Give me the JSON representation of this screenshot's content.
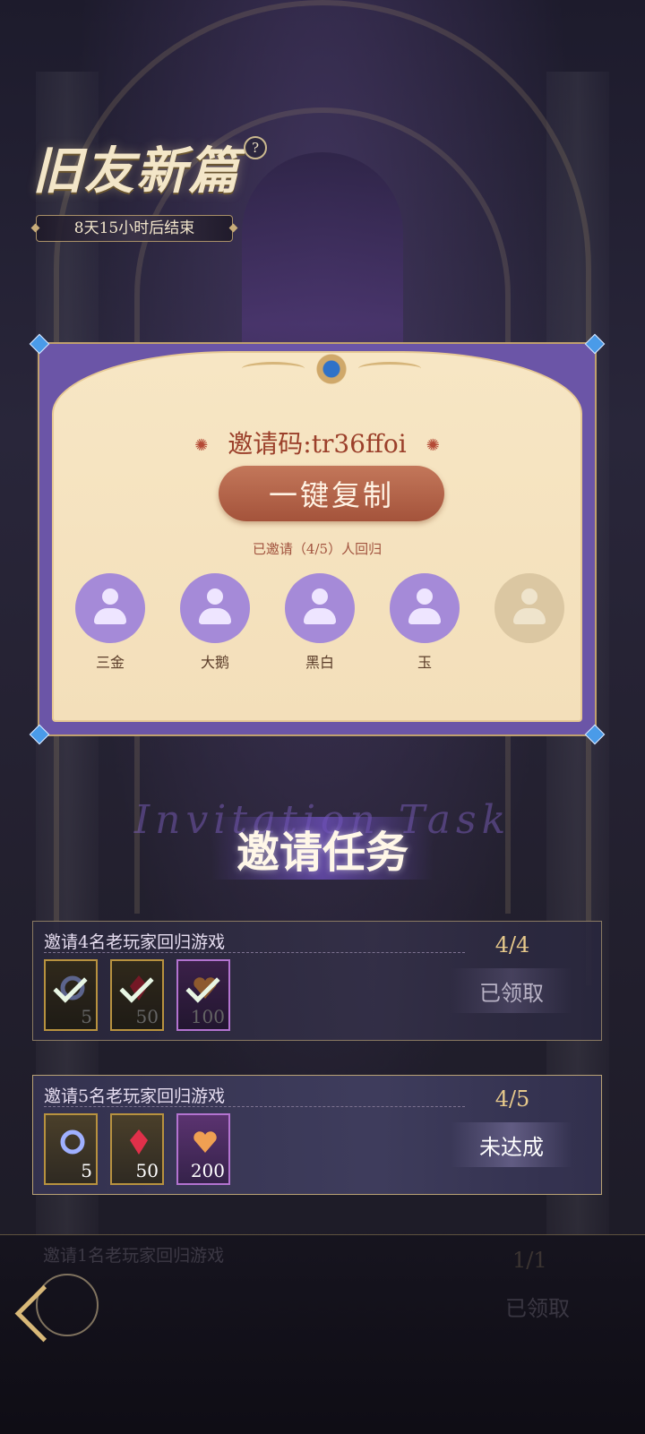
{
  "event": {
    "title": "旧友新篇",
    "help_icon": "question-mark-icon",
    "help_glyph": "?",
    "timer": "8天15小时后结束"
  },
  "invite": {
    "code_text": "邀请码:tr36ffoi",
    "copy_button": "一键复制",
    "status_text": "已邀请（4/5）人回归",
    "friends": [
      {
        "name": "三金",
        "state": "joined"
      },
      {
        "name": "大鹅",
        "state": "joined"
      },
      {
        "name": "黑白",
        "state": "joined"
      },
      {
        "name": "玉",
        "state": "joined"
      },
      {
        "name": "",
        "state": "empty"
      }
    ]
  },
  "tasks_section": {
    "title": "邀请任务",
    "bg_text": "Invitation Task"
  },
  "tasks": [
    {
      "title": "邀请4名老玩家回归游戏",
      "progress": "4/4",
      "button": "已领取",
      "state": "claimed",
      "rewards": [
        {
          "icon": "ring-icon",
          "count": "5",
          "rarity": "gold",
          "claimed": true
        },
        {
          "icon": "crystal-icon",
          "count": "50",
          "rarity": "gold",
          "claimed": true
        },
        {
          "icon": "heart-icon",
          "count": "100",
          "rarity": "purple",
          "claimed": true
        }
      ]
    },
    {
      "title": "邀请5名老玩家回归游戏",
      "progress": "4/5",
      "button": "未达成",
      "state": "pending",
      "rewards": [
        {
          "icon": "ring-icon",
          "count": "5",
          "rarity": "gold",
          "claimed": false
        },
        {
          "icon": "crystal-icon",
          "count": "50",
          "rarity": "gold",
          "claimed": false
        },
        {
          "icon": "heart-icon",
          "count": "200",
          "rarity": "purple",
          "claimed": false
        }
      ]
    },
    {
      "title": "邀请1名老玩家回归游戏",
      "progress": "1/1",
      "button": "已领取",
      "state": "claimed-partial"
    }
  ],
  "nav": {
    "back_icon": "back-arrow-icon"
  },
  "colors": {
    "accent_gold": "#d8b878",
    "card_purple": "#6b55a7",
    "card_cream": "#f7e6c4",
    "button_brown": "#a4533b",
    "avatar_purple": "#a58ad8"
  }
}
